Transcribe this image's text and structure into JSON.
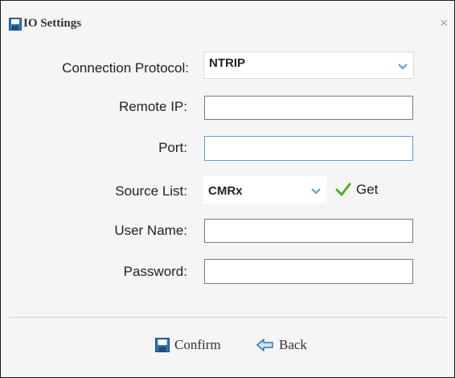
{
  "window": {
    "title": "IO Settings",
    "close_label": "×"
  },
  "form": {
    "connection_protocol": {
      "label": "Connection Protocol:",
      "value": "NTRIP"
    },
    "remote_ip": {
      "label": "Remote IP:",
      "value": ""
    },
    "port": {
      "label": "Port:",
      "value": ""
    },
    "source_list": {
      "label": "Source List:",
      "value": "CMRx",
      "get_label": "Get"
    },
    "user_name": {
      "label": "User Name:",
      "value": ""
    },
    "password": {
      "label": "Password:",
      "value": ""
    }
  },
  "footer": {
    "confirm_label": "Confirm",
    "back_label": "Back"
  },
  "colors": {
    "accent": "#2e75b6",
    "check": "#4caf1f",
    "focus_border": "#5b9bd5"
  },
  "icons": {
    "title": "floppy-disk-icon",
    "close": "close-icon",
    "dropdown": "chevron-down-icon",
    "get": "checkmark-icon",
    "confirm": "floppy-disk-icon",
    "back": "back-arrow-icon"
  }
}
